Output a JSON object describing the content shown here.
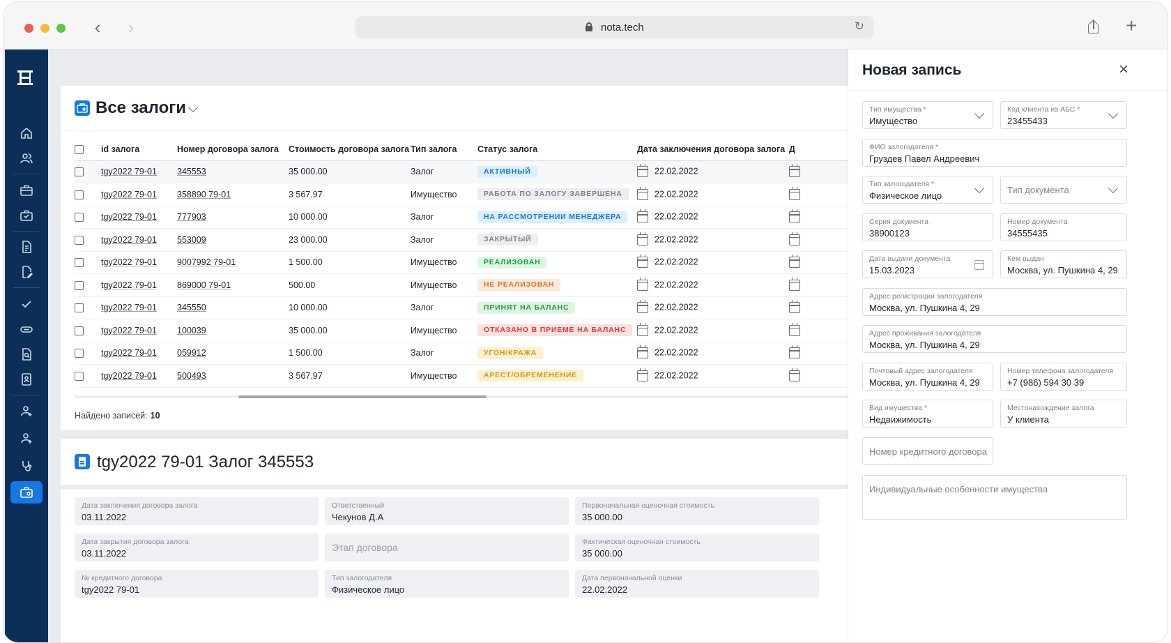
{
  "browser": {
    "url": "nota.tech"
  },
  "table": {
    "title": "Все залоги",
    "columns": [
      "id залога",
      "Номер договора залога",
      "Стоимость договора залога",
      "Тип залога",
      "Статус залога",
      "Дата заключения договора залога",
      "Д"
    ],
    "rows": [
      {
        "id": "tgy2022 79-01",
        "number": "345553",
        "cost": "35 000.00",
        "type": "Залог",
        "status": "АКТИВНЫЙ",
        "status_bg": "#dcefff",
        "status_fg": "#1479e3",
        "date": "22.02.2022"
      },
      {
        "id": "tgy2022 79-01",
        "number": "358890 79-01",
        "cost": "3 567.97",
        "type": "Имущество",
        "status": "РАБОТА ПО ЗАЛОГУ ЗАВЕРШЕНА",
        "status_bg": "#eceef1",
        "status_fg": "#7d828b",
        "date": "22.02.2022"
      },
      {
        "id": "tgy2022 79-01",
        "number": "777903",
        "cost": "10 000.00",
        "type": "Залог",
        "status": "НА РАССМОТРЕНИИ МЕНЕДЖЕРА",
        "status_bg": "#dcefff",
        "status_fg": "#1479e3",
        "date": "22.02.2022"
      },
      {
        "id": "tgy2022 79-01",
        "number": "553009",
        "cost": "23 000.00",
        "type": "Залог",
        "status": "ЗАКРЫТЫЙ",
        "status_bg": "#eceef1",
        "status_fg": "#7d828b",
        "date": "22.02.2022"
      },
      {
        "id": "tgy2022 79-01",
        "number": "9007992 79-01",
        "cost": "1 500.00",
        "type": "Имущество",
        "status": "РЕАЛИЗОВАН",
        "status_bg": "#dff5e3",
        "status_fg": "#1f9b3e",
        "date": "22.02.2022"
      },
      {
        "id": "tgy2022 79-01",
        "number": "869000 79-01",
        "cost": "500.00",
        "type": "Имущество",
        "status": "НЕ РЕАЛИЗОВАН",
        "status_bg": "#fde8da",
        "status_fg": "#e0742d",
        "date": "22.02.2022"
      },
      {
        "id": "tgy2022 79-01",
        "number": "345550",
        "cost": "10 000.00",
        "type": "Залог",
        "status": "ПРИНЯТ НА БАЛАНС",
        "status_bg": "#dff5e3",
        "status_fg": "#1f9b3e",
        "date": "22.02.2022"
      },
      {
        "id": "tgy2022 79-01",
        "number": "100039",
        "cost": "35 000.00",
        "type": "Имущество",
        "status": "ОТКАЗАНО В ПРИЕМЕ НА БАЛАНС",
        "status_bg": "#fde0e0",
        "status_fg": "#e03a3a",
        "date": "22.02.2022"
      },
      {
        "id": "tgy2022 79-01",
        "number": "059912",
        "cost": "1 500.00",
        "type": "Залог",
        "status": "УГОН/КРАЖА",
        "status_bg": "#fdf0cf",
        "status_fg": "#d39a12",
        "date": "22.02.2022"
      },
      {
        "id": "tgy2022 79-01",
        "number": "500493",
        "cost": "3 567.97",
        "type": "Имущество",
        "status": "АРЕСТ/ОБРЕМЕНЕНИЕ",
        "status_bg": "#fdf0cf",
        "status_fg": "#d39a12",
        "date": "22.02.2022"
      }
    ],
    "found_label": "Найдено записей:",
    "found_count": "10"
  },
  "detail": {
    "title": "tgy2022 79-01 Залог 345553",
    "fields": [
      {
        "label": "Дата заключения договора залога",
        "value": "03.11.2022"
      },
      {
        "label": "Ответственный",
        "value": "Чекунов Д.А"
      },
      {
        "label": "Первоначальная оценочная стоимость",
        "value": "35 000.00"
      },
      {
        "label": "Дата закрытия договора залога",
        "value": "03.11.2022"
      },
      {
        "label": "",
        "placeholder": "Этап договора"
      },
      {
        "label": "Фактическая оценочная стоимость",
        "value": "35 000.00"
      },
      {
        "label": "№ кредитного договора",
        "value": "tgy2022 79-01"
      },
      {
        "label": "Тип залогодателя",
        "value": "Физическое лицо"
      },
      {
        "label": "Дата первоначальной оценки",
        "value": "22.02.2022"
      }
    ]
  },
  "drawer": {
    "title": "Новая запись",
    "close": "×",
    "property_type": {
      "label": "Тип имущества *",
      "value": "Имущество"
    },
    "client_code": {
      "label": "Код клиента из АБС *",
      "value": "23455433"
    },
    "pledger_name": {
      "label": "ФИО залогодателя *",
      "value": "Груздев Павел Андреевич"
    },
    "pledger_type": {
      "label": "Тип залогодателя *",
      "value": "Физическое лицо"
    },
    "doc_type": {
      "placeholder": "Тип документа"
    },
    "doc_series": {
      "label": "Серия документа",
      "value": "38900123"
    },
    "doc_number": {
      "label": "Номер документа",
      "value": "34555435"
    },
    "doc_issue_date": {
      "label": "Дата выдачи документа",
      "value": "15.03.2023"
    },
    "doc_issued_by": {
      "label": "Кем выдан",
      "value": "Москва, ул. Пушкина 4, 29"
    },
    "reg_address": {
      "label": "Адрес регистрации залогодателя",
      "value": "Москва, ул. Пушкина 4, 29"
    },
    "live_address": {
      "label": "Адрес проживания залогодателя",
      "value": "Москва, ул. Пушкина 4, 29"
    },
    "post_address": {
      "label": "Почтовый адрес залогодателя",
      "value": "Москва, ул. Пушкина 4, 29"
    },
    "phone": {
      "label": "Номер телефона залогодателя",
      "value": "+7 (986) 594 30 39"
    },
    "property_kind": {
      "label": "Вид имущества *",
      "value": "Недвижимость"
    },
    "location": {
      "label": "Местонахождение залога",
      "value": "У клиента"
    },
    "credit_number": {
      "placeholder": "Номер кредитного договора"
    },
    "features": {
      "placeholder": "Индивидуальные особенности имущества"
    }
  },
  "colors": {
    "sidebar": "#0c2f59",
    "accent": "#1479e3"
  }
}
